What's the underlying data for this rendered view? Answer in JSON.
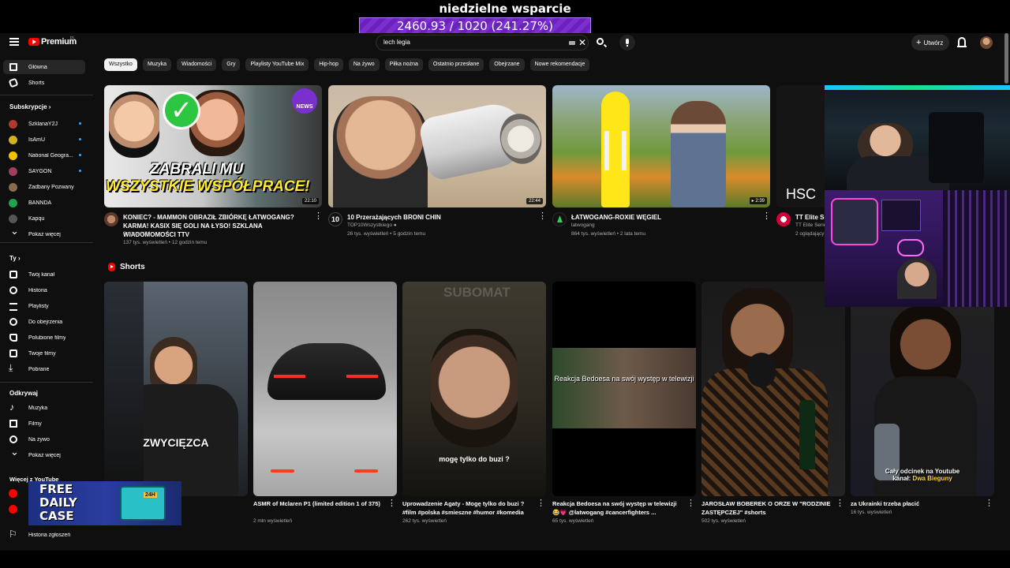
{
  "overlay": {
    "title": "niedzielne wsparcie",
    "progress_text": "2460.93 / 1020 (241.27%)",
    "progress_fraction": 2.4127,
    "promo_line1": "FREE",
    "promo_line2": "DAILY",
    "promo_line3": "CASE",
    "promo_badge": "24H"
  },
  "topbar": {
    "logo_text": "Premium",
    "logo_sup": "PL",
    "search_value": "lech legia",
    "create_label": "Utwórz"
  },
  "sidebar": {
    "main": [
      {
        "label": "Główna",
        "icon": "home-icon"
      },
      {
        "label": "Shorts",
        "icon": "shorts-icon"
      }
    ],
    "subs_header": "Subskrypcje",
    "subs": [
      {
        "label": "SzklanaY2J",
        "color": "#b03a2e",
        "new": true
      },
      {
        "label": "IsAmU",
        "color": "#d4b21c",
        "new": true
      },
      {
        "label": "National Geogra...",
        "color": "#f2c300",
        "new": true
      },
      {
        "label": "SAYGON",
        "color": "#a23d5c",
        "new": true
      },
      {
        "label": "Zadbany Pozwany",
        "color": "#8a6b4e",
        "new": false
      },
      {
        "label": "BANNDA",
        "color": "#1fa350",
        "new": false
      },
      {
        "label": "Kapqu",
        "color": "#555555",
        "new": false
      },
      {
        "label": "Pokaż więcej",
        "color": "",
        "new": false
      }
    ],
    "you_header": "Ty",
    "you": [
      {
        "label": "Twój kanał",
        "icon": "user-icon"
      },
      {
        "label": "Historia",
        "icon": "history-icon"
      },
      {
        "label": "Playlisty",
        "icon": "playlist-icon"
      },
      {
        "label": "Do obejrzenia",
        "icon": "clock-icon"
      },
      {
        "label": "Polubione filmy",
        "icon": "like-icon"
      },
      {
        "label": "Twoje filmy",
        "icon": "video-icon"
      },
      {
        "label": "Pobrane",
        "icon": "download-icon"
      }
    ],
    "explore_header": "Odkrywaj",
    "explore": [
      {
        "label": "Muzyka",
        "icon": "music-icon"
      },
      {
        "label": "Filmy",
        "icon": "film-icon"
      },
      {
        "label": "Na żywo",
        "icon": "live-icon"
      },
      {
        "label": "Pokaż więcej",
        "icon": "chevron-down-icon"
      }
    ],
    "more_header": "Więcej z YouTube",
    "report_history": "Historia zgłoszeń"
  },
  "chips": [
    "Wszystko",
    "Muzyka",
    "Wiadomości",
    "Gry",
    "Playlisty YouTube Mix",
    "Hip-hop",
    "Na żywo",
    "Piłka nożna",
    "Ostatnio przesłane",
    "Obejrzane",
    "Nowe rekomendacje"
  ],
  "videos": [
    {
      "title": "KONIEC? - MAMMON OBRAZIŁ ZBIÓRKĘ ŁATWOGANG? KARMA! KASIX SIĘ GOLI NA ŁYSO! SZKLANA WIADOMOMOŚCI TTV",
      "channel": "SzklanaY2J",
      "meta": "137 tys. wyświetleń • 12 godzin temu",
      "duration": "22:10",
      "thumb_text1": "ZABRALI MU",
      "thumb_text2": "WSZYSTKIE WSPÓŁPRACE!",
      "thumb_badge": "NEWS"
    },
    {
      "title": "10 Przerażających BRONI CHIN",
      "channel": "TOP10Wszystkiego",
      "meta": "26 tys. wyświetleń • 5 godzin temu",
      "duration": "22:44",
      "avatar_text": "10"
    },
    {
      "title": "ŁATWOGANG-ROXIE WĘGIEL",
      "channel": "latwogang",
      "meta": "864 tys. wyświetleń • 2 lata temu",
      "duration": "2:39"
    },
    {
      "title": "TT Elite Seri",
      "channel": "TT Elite Serie",
      "meta": "2 oglądający",
      "thumb_text1": "HSC"
    }
  ],
  "shorts_header": "Shorts",
  "shorts": [
    {
      "title": "",
      "views": "",
      "caption": "ZWYCIĘZCA"
    },
    {
      "title": "ASMR of Mclaren P1 (limited edition 1 of 375)",
      "views": "2 mln wyświetleń",
      "caption": ""
    },
    {
      "title": "Uprowadzenie Agaty - Mogę tylko do buzi ? #film #polska #smieszne #humor #komedia",
      "views": "262 tys. wyświetleń",
      "caption": "mogę tylko do buzi ?",
      "watermark": "SUBOMAT"
    },
    {
      "title": "Reakcja Bedoesa na swój występ w telewizji 😂💗 @latwogang #cancerfighters ...",
      "views": "65 tys. wyświetleń",
      "caption": "Reakcja Bedoesa na swój występ w telewizji"
    },
    {
      "title": "JAROSŁAW BOBEREK O ORZE W \"RODZINIE ZASTĘPCZEJ\" #shorts",
      "views": "502 tys. wyświetleń",
      "caption": ""
    },
    {
      "title": "za Ukrainki trzeba płacić",
      "views": "16 tys. wyświetleń",
      "caption": "Cały odcinek na Youtube",
      "caption2_prefix": "kanał: ",
      "caption2_name": "Dwa Bieguny"
    }
  ]
}
